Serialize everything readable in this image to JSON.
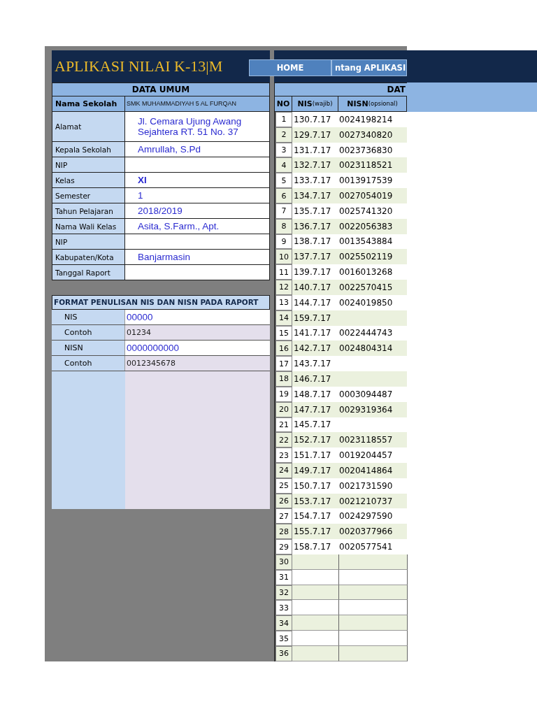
{
  "title": "APLIKASI NILAI K-13|M",
  "nav_buttons": [
    {
      "label": "HOME"
    },
    {
      "label": "ntang APLIKASI"
    }
  ],
  "data_umum": {
    "heading": "DATA UMUM",
    "fields": [
      {
        "kind": "school",
        "label": "Nama Sekolah",
        "value": "SMK MUHAMMADIYAH 5 AL FURQAN",
        "emphasis": false
      },
      {
        "kind": "entry",
        "label": "Alamat",
        "value": "Jl. Cemara Ujung Awang Sejahtera RT. 51 No. 37",
        "emphasis": false
      },
      {
        "kind": "entry",
        "label": "Kepala Sekolah",
        "value": "Amrullah, S.Pd",
        "emphasis": false
      },
      {
        "kind": "entry",
        "label": "NIP"
      },
      {
        "kind": "entry",
        "label": "Kelas",
        "value": "XI",
        "emphasis": true
      },
      {
        "kind": "entry",
        "label": "Semester",
        "value": "1",
        "emphasis": false
      },
      {
        "kind": "entry",
        "label": "Tahun Pelajaran",
        "value": "2018/2019",
        "emphasis": false
      },
      {
        "kind": "entry",
        "label": "Nama Wali Kelas",
        "value": "Asita, S.Farm., Apt.",
        "emphasis": false
      },
      {
        "kind": "entry",
        "label": "NIP"
      },
      {
        "kind": "entry",
        "label": "Kabupaten/Kota",
        "value": "Banjarmasin",
        "emphasis": false
      },
      {
        "kind": "entry",
        "label": "Tanggal Raport"
      }
    ]
  },
  "format": {
    "heading": "FORMAT PENULISAN NIS DAN NISN PADA RAPORT",
    "rows": [
      {
        "kind": "pattern",
        "label": "NIS",
        "value": "00000"
      },
      {
        "kind": "example",
        "label": "Contoh",
        "value": "01234"
      },
      {
        "kind": "pattern",
        "label": "NISN",
        "value": "0000000000"
      },
      {
        "kind": "example",
        "label": "Contoh",
        "value": "0012345678"
      }
    ]
  },
  "students": {
    "heading": "DAT",
    "columns": [
      {
        "main": "NO"
      },
      {
        "main": "NIS",
        "note": "(wajib)"
      },
      {
        "main": "NISN",
        "note": "(opsional)"
      }
    ],
    "rows": [
      {
        "no": "1",
        "nis": "130.7.17",
        "nisn": "0024198214"
      },
      {
        "no": "2",
        "nis": "129.7.17",
        "nisn": "0027340820"
      },
      {
        "no": "3",
        "nis": "131.7.17",
        "nisn": "0023736830"
      },
      {
        "no": "4",
        "nis": "132.7.17",
        "nisn": "0023118521"
      },
      {
        "no": "5",
        "nis": "133.7.17",
        "nisn": "0013917539"
      },
      {
        "no": "6",
        "nis": "134.7.17",
        "nisn": "0027054019"
      },
      {
        "no": "7",
        "nis": "135.7.17",
        "nisn": "0025741320"
      },
      {
        "no": "8",
        "nis": "136.7.17",
        "nisn": "0022056383"
      },
      {
        "no": "9",
        "nis": "138.7.17",
        "nisn": "0013543884"
      },
      {
        "no": "10",
        "nis": "137.7.17",
        "nisn": "0025502119"
      },
      {
        "no": "11",
        "nis": "139.7.17",
        "nisn": "0016013268"
      },
      {
        "no": "12",
        "nis": "140.7.17",
        "nisn": "0022570415"
      },
      {
        "no": "13",
        "nis": "144.7.17",
        "nisn": "0024019850"
      },
      {
        "no": "14",
        "nis": "159.7.17"
      },
      {
        "no": "15",
        "nis": "141.7.17",
        "nisn": "0022444743"
      },
      {
        "no": "16",
        "nis": "142.7.17",
        "nisn": "0024804314"
      },
      {
        "no": "17",
        "nis": "143.7.17"
      },
      {
        "no": "18",
        "nis": "146.7.17"
      },
      {
        "no": "19",
        "nis": "148.7.17",
        "nisn": "0003094487"
      },
      {
        "no": "20",
        "nis": "147.7.17",
        "nisn": "0029319364"
      },
      {
        "no": "21",
        "nis": "145.7.17"
      },
      {
        "no": "22",
        "nis": "152.7.17",
        "nisn": "0023118557"
      },
      {
        "no": "23",
        "nis": "151.7.17",
        "nisn": "0019204457"
      },
      {
        "no": "24",
        "nis": "149.7.17",
        "nisn": "0020414864"
      },
      {
        "no": "25",
        "nis": "150.7.17",
        "nisn": "0021731590"
      },
      {
        "no": "26",
        "nis": "153.7.17",
        "nisn": "0021210737"
      },
      {
        "no": "27",
        "nis": "154.7.17",
        "nisn": "0024297590"
      },
      {
        "no": "28",
        "nis": "155.7.17",
        "nisn": "0020377966"
      },
      {
        "no": "29",
        "nis": "158.7.17",
        "nisn": "0020577541"
      },
      {
        "no": "30"
      },
      {
        "no": "31"
      },
      {
        "no": "32"
      },
      {
        "no": "33"
      },
      {
        "no": "34"
      },
      {
        "no": "35"
      },
      {
        "no": "36"
      }
    ]
  }
}
